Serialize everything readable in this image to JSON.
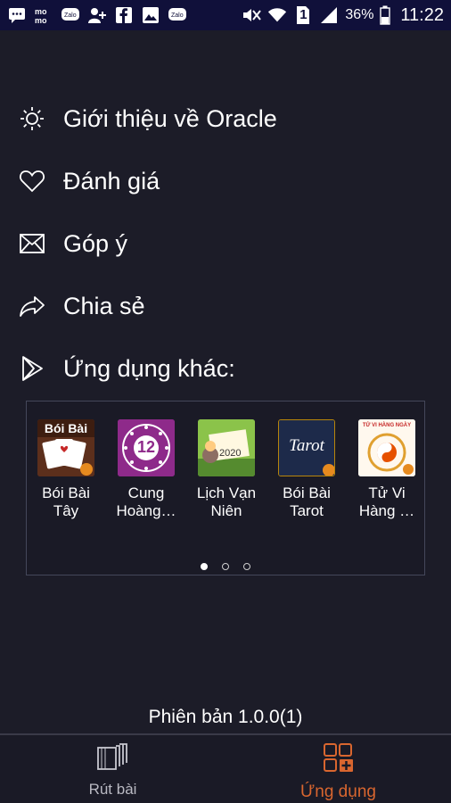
{
  "status_bar": {
    "battery_percent": "36%",
    "time": "11:22",
    "sim_label": "1",
    "icons": [
      "messages-icon",
      "momo-icon",
      "zalo-icon",
      "add-contact-icon",
      "facebook-icon",
      "gallery-icon",
      "zalo-icon",
      "mute-icon",
      "wifi-icon",
      "sim-icon",
      "signal-icon",
      "battery-icon"
    ]
  },
  "menu": {
    "items": [
      {
        "label": "Giới thiệu về Oracle",
        "icon": "sun-icon"
      },
      {
        "label": "Đánh giá",
        "icon": "heart-icon"
      },
      {
        "label": "Góp ý",
        "icon": "mail-icon"
      },
      {
        "label": "Chia sẻ",
        "icon": "share-icon"
      },
      {
        "label": "Ứng dụng khác:",
        "icon": "play-store-icon"
      }
    ]
  },
  "other_apps": {
    "apps": [
      {
        "label_1": "Bói Bài",
        "label_2": "Tây",
        "icon_text": "Bói Bài"
      },
      {
        "label_1": "Cung",
        "label_2": "Hoàng…",
        "icon_text": "12"
      },
      {
        "label_1": "Lịch Vạn",
        "label_2": "Niên",
        "icon_text": "2020"
      },
      {
        "label_1": "Bói Bài",
        "label_2": "Tarot",
        "icon_text": "Tarot"
      },
      {
        "label_1": "Tử Vi",
        "label_2": "Hàng …",
        "icon_text": "TỬ VI HÀNG NGÀY"
      }
    ],
    "page_count": 3,
    "active_page": 1
  },
  "version_text": "Phiên bản 1.0.0(1)",
  "bottom_nav": {
    "tabs": [
      {
        "label": "Rút bài",
        "icon": "cards-icon",
        "active": false
      },
      {
        "label": "Ứng dụng",
        "icon": "apps-grid-icon",
        "active": true
      }
    ]
  },
  "colors": {
    "background": "#1c1c28",
    "status_bar": "#10103a",
    "accent": "#d9662f"
  }
}
